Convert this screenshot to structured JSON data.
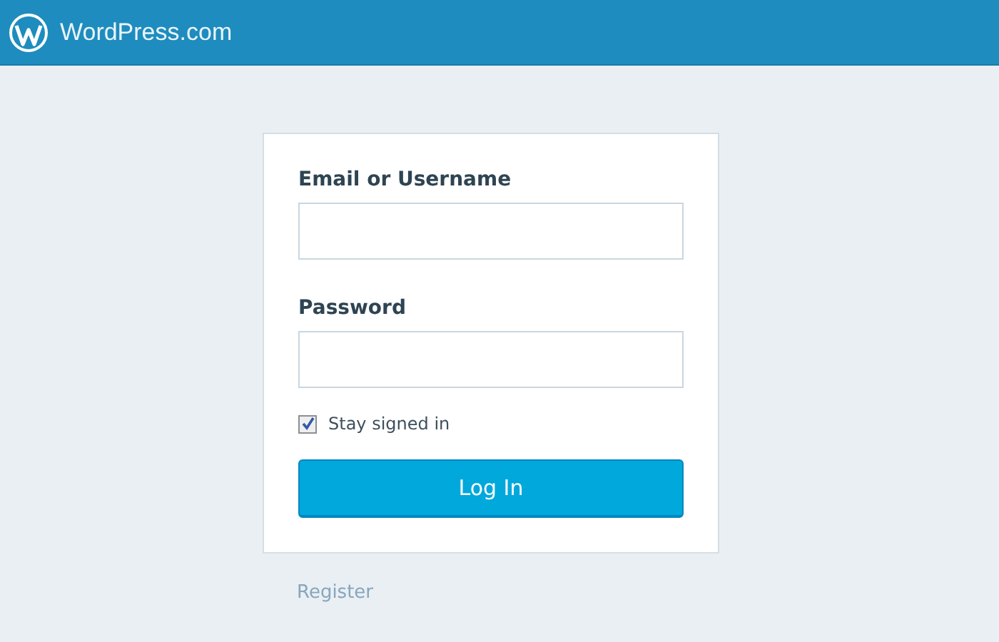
{
  "header": {
    "title": "WordPress.com"
  },
  "form": {
    "fields": [
      {
        "label": "Email or Username"
      },
      {
        "label": "Password"
      }
    ],
    "remember": {
      "label": "Stay signed in",
      "checked": true
    },
    "submit": "Log In"
  },
  "register_link": "Register"
}
